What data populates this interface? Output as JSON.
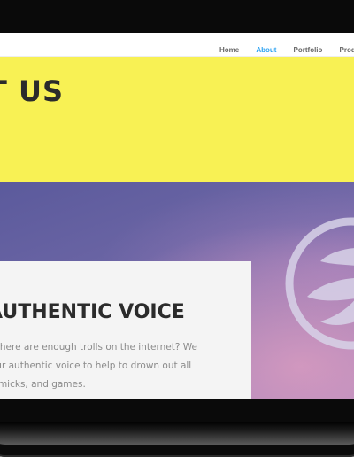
{
  "nav": {
    "items": [
      {
        "label": "Home"
      },
      {
        "label": "About"
      },
      {
        "label": "Portfolio"
      },
      {
        "label": "Product"
      }
    ],
    "active_color": "#2ea3f2"
  },
  "hero": {
    "title": "T US",
    "background": "#f8f154"
  },
  "card": {
    "heading": "AUTHENTIC VOICE",
    "body_lines": [
      "think there are enough trolls on the internet? We",
      "dd your authentic voice to help to drown out all",
      "s, gimmicks, and games."
    ]
  },
  "logo": {
    "icon": "circle-swoosh-logo-icon"
  }
}
